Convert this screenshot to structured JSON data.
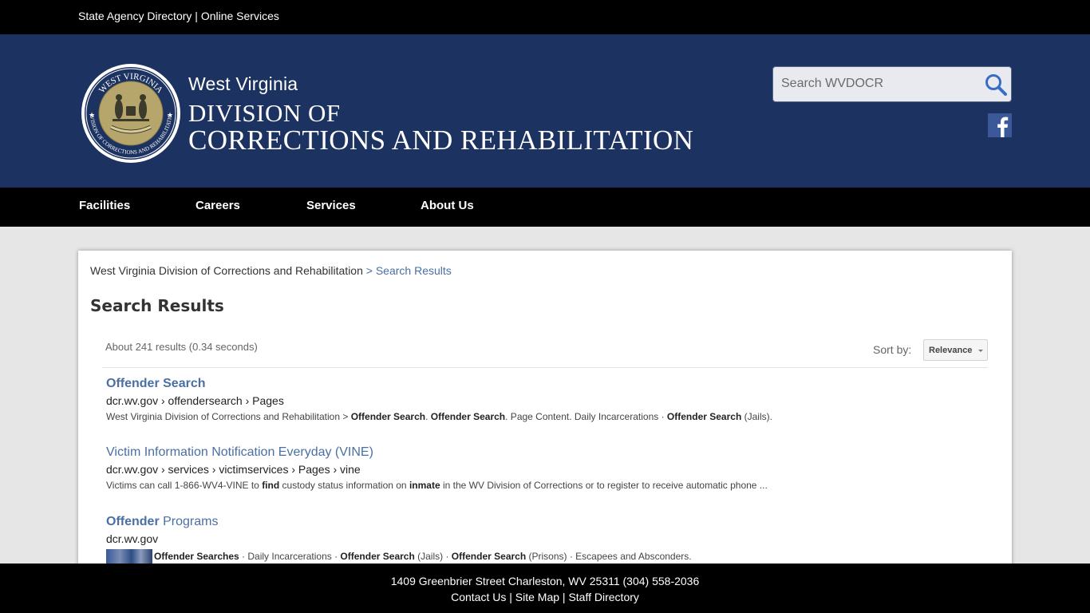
{
  "topbar": {
    "agency_directory": "State Agency Directory",
    "separator": "|",
    "online_services": "Online Services"
  },
  "header": {
    "seal": {
      "text_top": "WEST VIRGINIA",
      "text_bottom": "DIVISION OF CORRECTIONS AND REHABILITATION"
    },
    "state": "West Virginia",
    "division_line1": "DIVISION OF",
    "division_line2": "CORRECTIONS AND REHABILITATION",
    "search_placeholder": "Search WVDOCR",
    "search_icon": "search-icon",
    "social_icon": "facebook-icon",
    "colors": {
      "header_bg": "#1c3260",
      "seal_gold": "#b7a66c",
      "facebook": "#3b5998"
    }
  },
  "nav": {
    "items": [
      {
        "label": "Facilities"
      },
      {
        "label": "Careers"
      },
      {
        "label": "Services"
      },
      {
        "label": "About Us"
      }
    ]
  },
  "breadcrumb": {
    "home": "West Virginia Division of Corrections and Rehabilitation",
    "current": "> Search Results"
  },
  "page_title": "Search Results",
  "results_meta": {
    "count_text": "About 241 results (0.34 seconds)",
    "sort_label": "Sort by:",
    "sort_value": "Relevance"
  },
  "results": [
    {
      "title": "Offender Search",
      "url": "dcr.wv.gov › offendersearch › Pages",
      "snippet": [
        {
          "t": "West Virginia Division of Corrections and Rehabilitation > ",
          "b": false
        },
        {
          "t": "Offender Search",
          "b": true
        },
        {
          "t": ". ",
          "b": false
        },
        {
          "t": "Offender Search",
          "b": true
        },
        {
          "t": ". Page Content. Daily Incarcerations · ",
          "b": false
        },
        {
          "t": "Offender Search",
          "b": true
        },
        {
          "t": " (Jails).",
          "b": false
        }
      ]
    },
    {
      "title": "Victim Information Notification Everyday (VINE)",
      "url": "dcr.wv.gov › services › victimservices › Pages › vine",
      "snippet": [
        {
          "t": "Victims can call 1-866-WV4-VINE to ",
          "b": false
        },
        {
          "t": "find",
          "b": true
        },
        {
          "t": " custody status information on ",
          "b": false
        },
        {
          "t": "inmate",
          "b": true
        },
        {
          "t": " in the WV Division of Corrections or to register to receive automatic phone ...",
          "b": false
        }
      ]
    },
    {
      "title_bold": "Offender",
      "title_rest": " Programs",
      "url": "dcr.wv.gov",
      "snippet": [
        {
          "t": "Offender Searches",
          "b": true
        },
        {
          "t": " · Daily Incarcerations · ",
          "b": false
        },
        {
          "t": "Offender Search",
          "b": true
        },
        {
          "t": " (Jails) · ",
          "b": false
        },
        {
          "t": "Offender Search",
          "b": true
        },
        {
          "t": " (Prisons) · Escapees and Absconders.",
          "b": false
        }
      ]
    }
  ],
  "footer": {
    "address": "1409 Greenbrier Street Charleston, WV 25311 (304) 558-2036",
    "links": [
      {
        "label": "Contact Us"
      },
      {
        "label": "Site Map"
      },
      {
        "label": "Staff Directory"
      }
    ],
    "separator": "|"
  }
}
